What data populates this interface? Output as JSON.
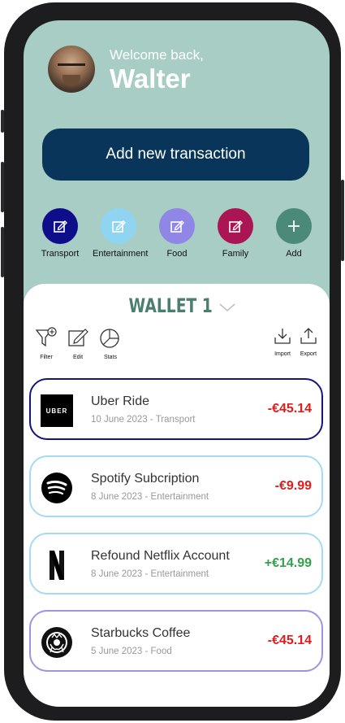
{
  "header": {
    "welcome": "Welcome back,",
    "name": "Walter"
  },
  "add_transaction_label": "Add new transaction",
  "categories": [
    {
      "label": "Transport",
      "color": "#0e0e8a",
      "icon": "edit-icon"
    },
    {
      "label": "Entertainment",
      "color": "#8fd4f0",
      "icon": "edit-icon"
    },
    {
      "label": "Food",
      "color": "#8f86e6",
      "icon": "edit-icon"
    },
    {
      "label": "Family",
      "color": "#aa1653",
      "icon": "edit-icon"
    },
    {
      "label": "Add",
      "color": "#4b8a79",
      "icon": "plus-icon"
    }
  ],
  "wallet": {
    "title": "WALLET 1"
  },
  "toolbar": {
    "filter": "Filter",
    "edit": "Edit",
    "stats": "Stats",
    "import": "Import",
    "export": "Export"
  },
  "transactions": [
    {
      "title": "Uber Ride",
      "subtitle": "10 June 2023 - Transport",
      "amount": "-€45.14",
      "amount_color": "#e01c1c",
      "border": "#15157a",
      "logo_text": "UBER",
      "icon": "uber-logo"
    },
    {
      "title": "Spotify Subcription",
      "subtitle": "8 June 2023 - Entertainment",
      "amount": "-€9.99",
      "amount_color": "#e01c1c",
      "border": "#a4dbf2",
      "icon": "spotify-logo"
    },
    {
      "title": "Refound Netflix Account",
      "subtitle": "8 June 2023 - Entertainment",
      "amount": "+€14.99",
      "amount_color": "#35a04d",
      "border": "#a4dbf2",
      "icon": "netflix-logo"
    },
    {
      "title": "Starbucks Coffee",
      "subtitle": "5 June 2023 - Food",
      "amount": "-€45.14",
      "amount_color": "#e01c1c",
      "border": "#9d95e3",
      "icon": "starbucks-logo"
    }
  ],
  "colors": {
    "header_bg": "#a7cdc4",
    "primary_button": "#083559",
    "wallet_title": "#4a7f6f"
  }
}
